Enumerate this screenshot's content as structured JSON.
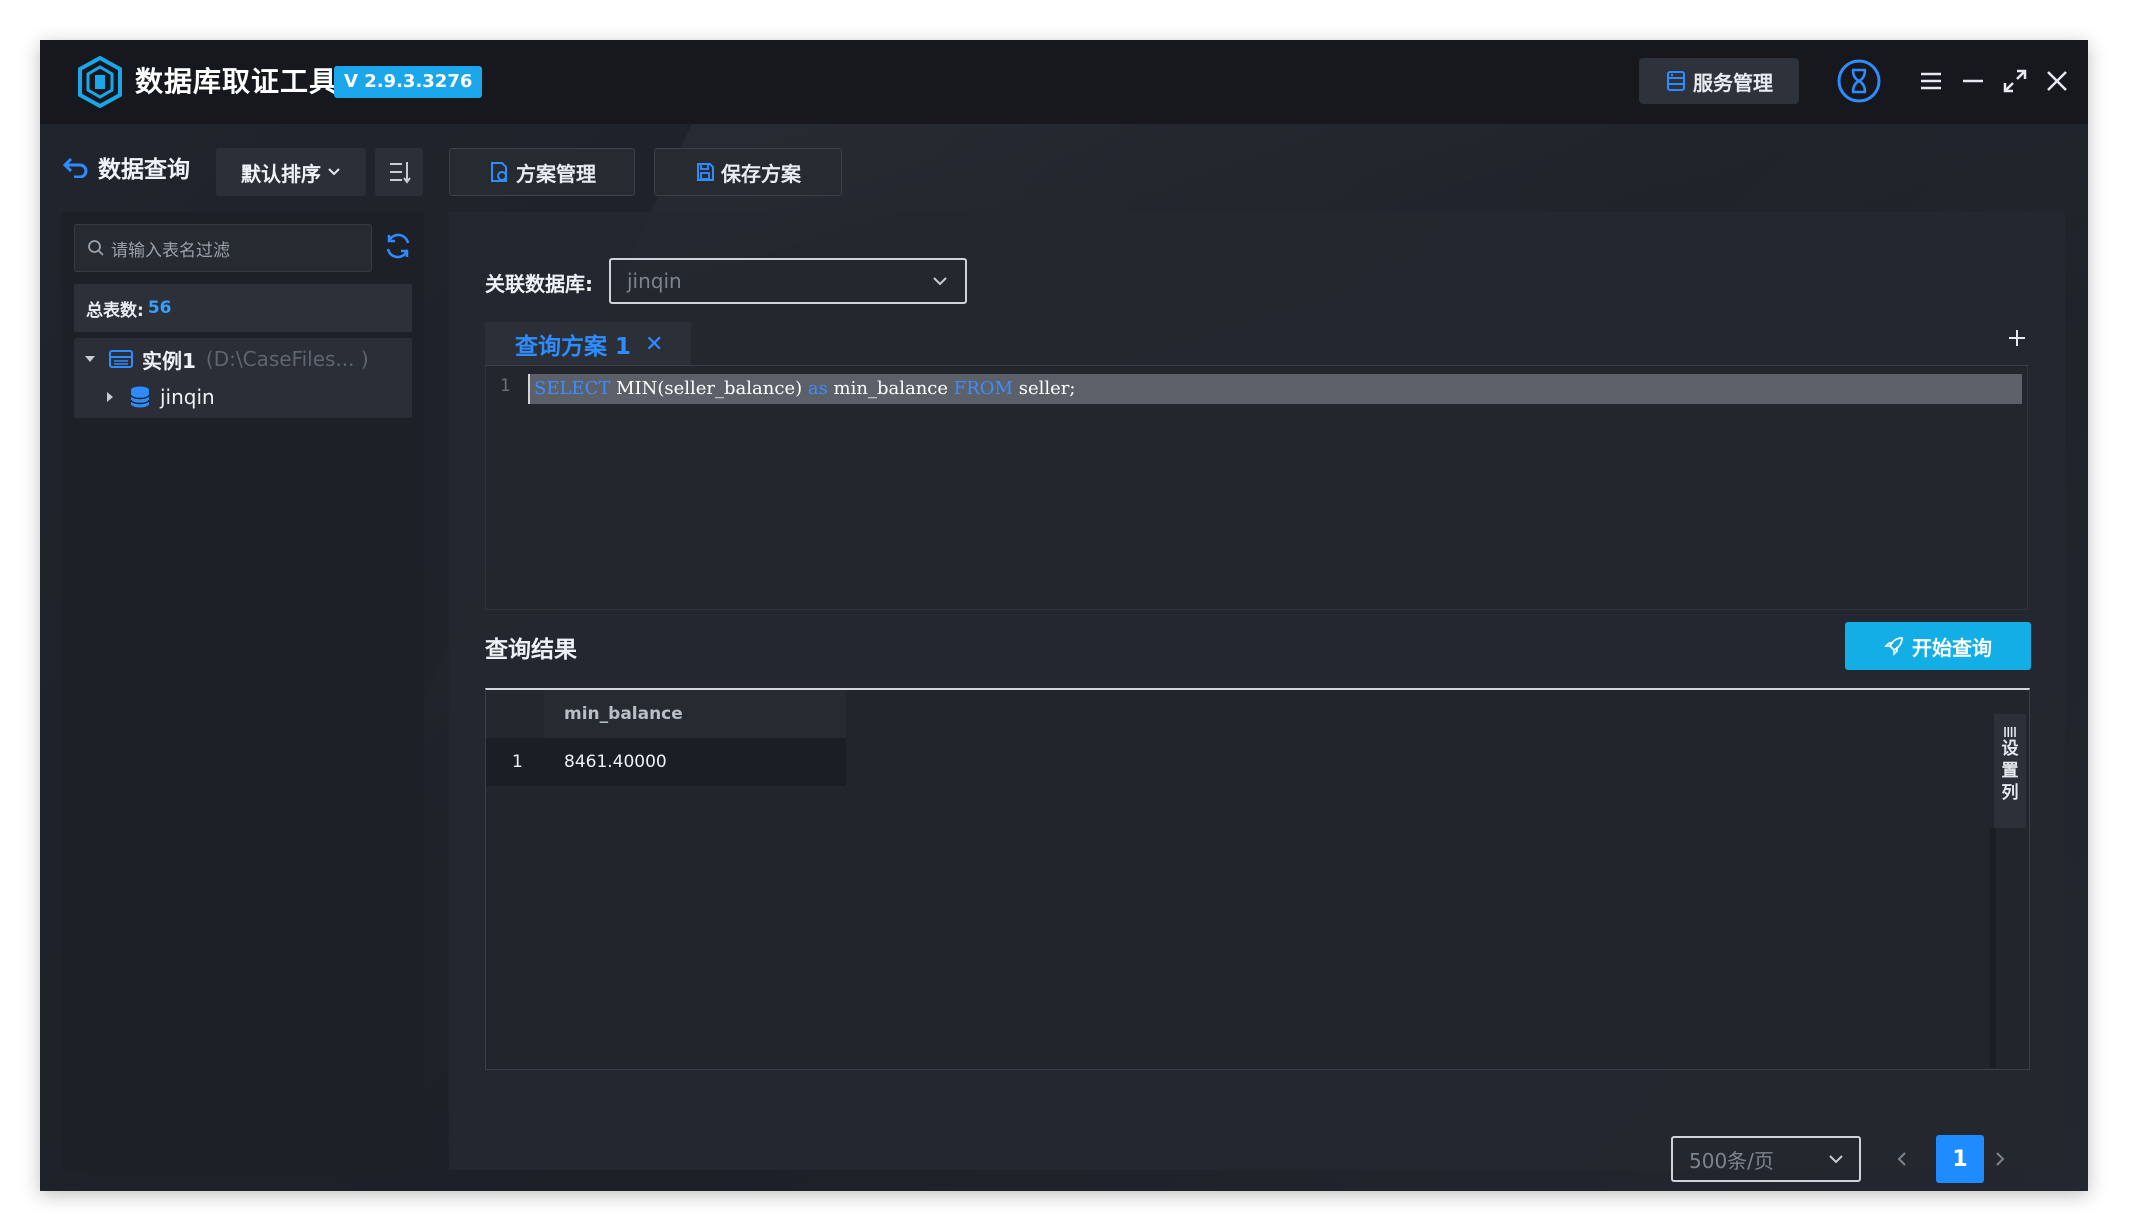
{
  "app": {
    "title": "数据库取证工具",
    "version": "V 2.9.3.3276",
    "service_button": "服务管理",
    "accent_color": "#1aa6e8"
  },
  "toolbar": {
    "back_label": "数据查询",
    "sort_label": "默认排序",
    "plan_manage_label": "方案管理",
    "save_plan_label": "保存方案"
  },
  "sidebar": {
    "filter_placeholder": "请输入表名过滤",
    "total_label": "总表数:",
    "total_value": "56",
    "instance_name": "实例1",
    "instance_path": "(D:\\CaseFiles... )",
    "database_name": "jinqin"
  },
  "query": {
    "db_label": "关联数据库:",
    "db_value": "jinqin",
    "tab_label": "查询方案 1",
    "line_number": "1",
    "sql_kw_select": "SELECT",
    "sql_part1": " MIN(seller_balance) ",
    "sql_kw_as": "as",
    "sql_part2": " min_balance ",
    "sql_kw_from": "FROM",
    "sql_part3": " seller;"
  },
  "results": {
    "title": "查询结果",
    "start_button": "开始查询",
    "column_header": "min_balance",
    "rows": [
      {
        "index": "1",
        "value": "8461.40000"
      }
    ],
    "col_settings_chars": [
      "设",
      "置",
      "列"
    ]
  },
  "pager": {
    "page_size": "500条/页",
    "current_page": "1"
  }
}
